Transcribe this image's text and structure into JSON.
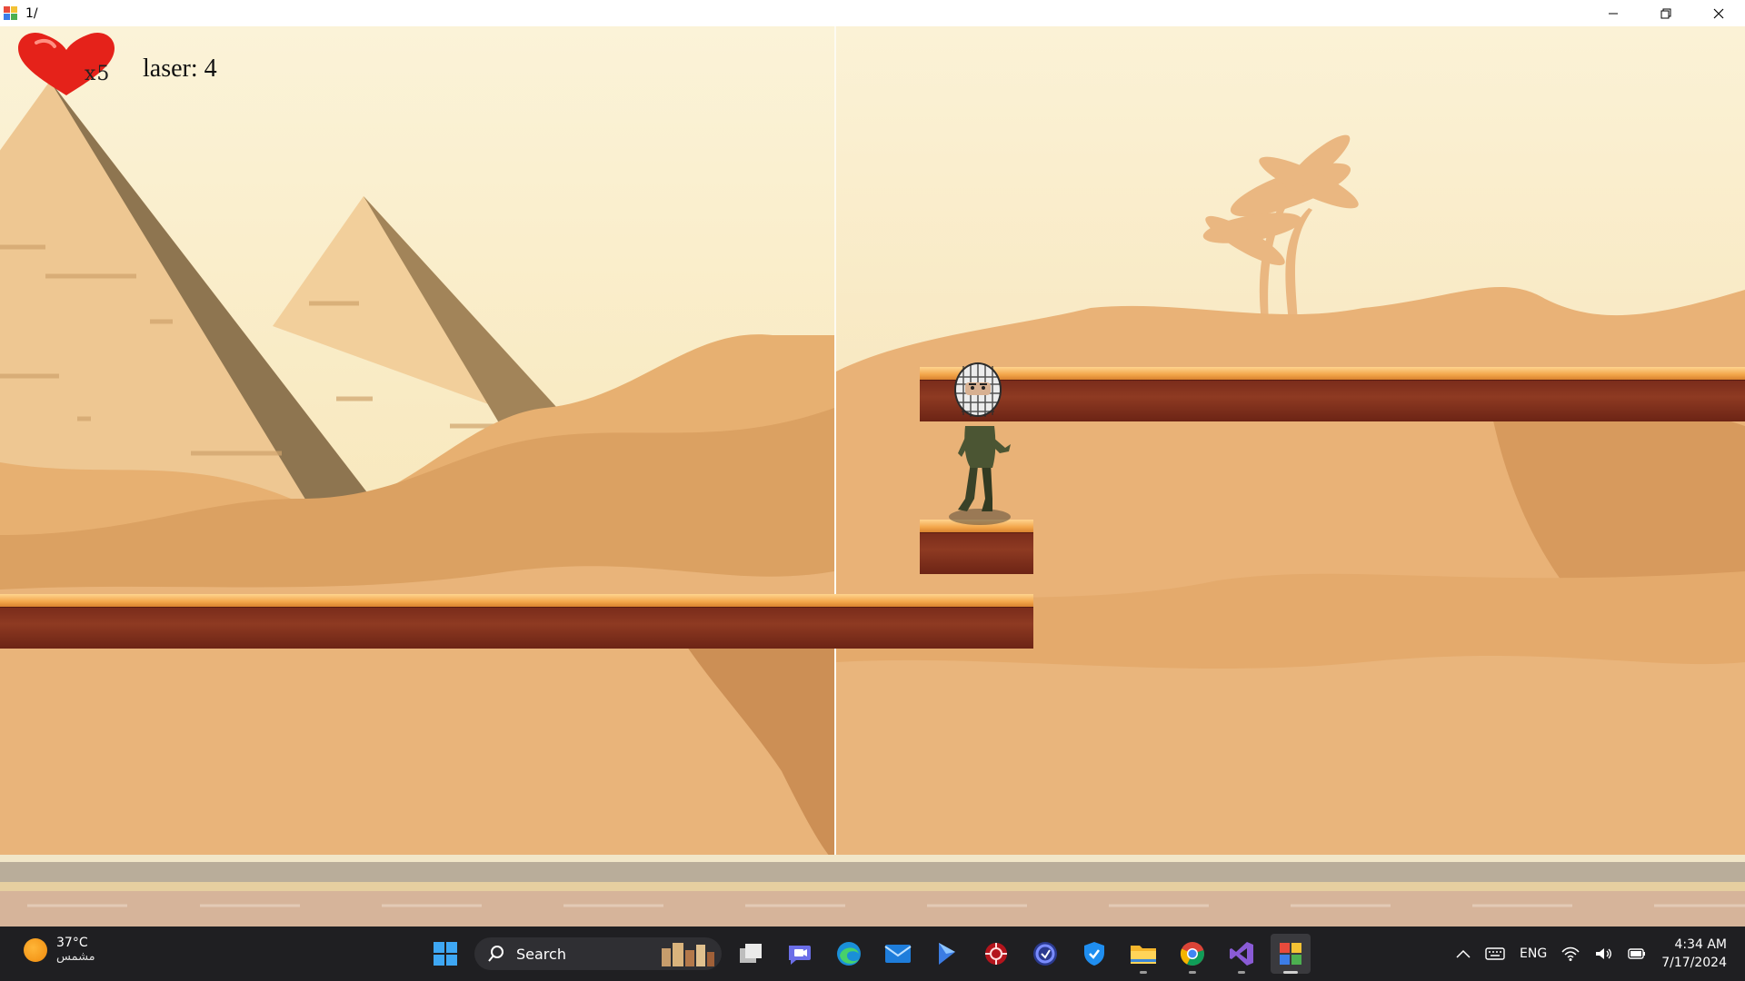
{
  "window": {
    "title": "1/"
  },
  "hud": {
    "lives_label": "x5",
    "lives": 5,
    "laser_label": "laser: 4",
    "laser": 4
  },
  "scene": {
    "background": "desert with pyramids and palm trees",
    "platforms": [
      "platform-ground-left",
      "platform-upper-right",
      "platform-small-block"
    ],
    "player": "soldier in keffiyeh"
  },
  "taskbar": {
    "weather_temp": "37°C",
    "weather_desc": "مشمس",
    "search_label": "Search",
    "apps": [
      "start-icon",
      "task-view-icon",
      "teams-icon",
      "edge-icon",
      "mail-icon",
      "copilot-icon",
      "antivirus-icon",
      "app-icon",
      "defender-icon",
      "file-explorer-icon",
      "chrome-icon",
      "visual-studio-icon",
      "game-app-icon"
    ],
    "tray_lang": "ENG",
    "time": "4:34 AM",
    "date": "7/17/2024"
  },
  "colors": {
    "sky": "#f8ebc4",
    "sand": "#e9b276",
    "platform_top": "#f3a64a",
    "platform_body": "#7f2f1c",
    "taskbar": "#1f1f22"
  }
}
